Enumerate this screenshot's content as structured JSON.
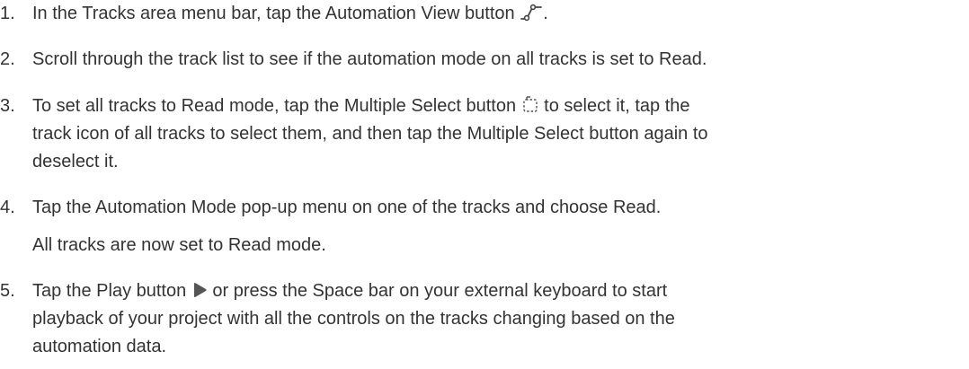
{
  "steps": [
    {
      "number": "1.",
      "text_before": "In the Tracks area menu bar, tap the Automation View button ",
      "icon": "automation-view-icon",
      "text_after": "."
    },
    {
      "number": "2.",
      "text": "Scroll through the track list to see if the automation mode on all tracks is set to Read."
    },
    {
      "number": "3.",
      "line1_before": "To set all tracks to Read mode, tap the Multiple Select button ",
      "icon": "multiple-select-icon",
      "line1_after": " to select it, tap the",
      "line2": "track icon of all tracks to select them, and then tap the Multiple Select button  again to",
      "line3": "deselect it."
    },
    {
      "number": "4.",
      "text": "Tap the Automation Mode pop-up menu on one of the tracks and choose Read.",
      "result": "All tracks are now set to Read mode."
    },
    {
      "number": "5.",
      "line1_before": "Tap the Play button ",
      "icon": "play-icon",
      "line1_after": " or press the Space bar on your external keyboard to start",
      "line2": "playback of your project with all the controls on the tracks changing based on the",
      "line3": "automation data."
    }
  ],
  "colors": {
    "text": "#333333",
    "background": "#ffffff"
  }
}
